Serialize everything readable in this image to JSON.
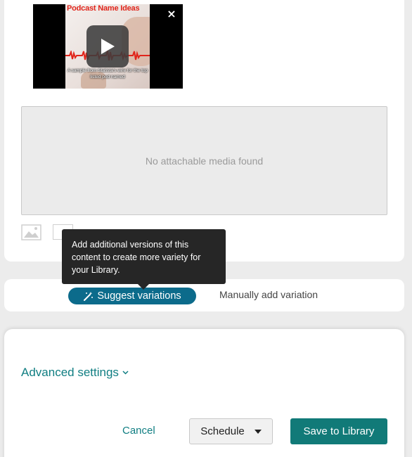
{
  "video": {
    "title": "Podcast Name Ideas",
    "caption": "A sample from Statista's wire for the top listed pod named",
    "close_glyph": "×",
    "play_icon": "play-icon"
  },
  "media": {
    "empty_text": "No attachable media found"
  },
  "tooltip": {
    "text": "Add additional versions of this content to create more variety for your Library."
  },
  "variations": {
    "suggest_label": "Suggest variations",
    "suggest_icon": "magic-wand-icon",
    "manual_label": "Manually add variation",
    "accent_color": "#0c6b8b"
  },
  "settings": {
    "advanced_label": "Advanced settings",
    "chevron_glyph": "⌄"
  },
  "actions": {
    "cancel_label": "Cancel",
    "schedule_label": "Schedule",
    "save_label": "Save to Library",
    "save_color": "#117a78"
  }
}
